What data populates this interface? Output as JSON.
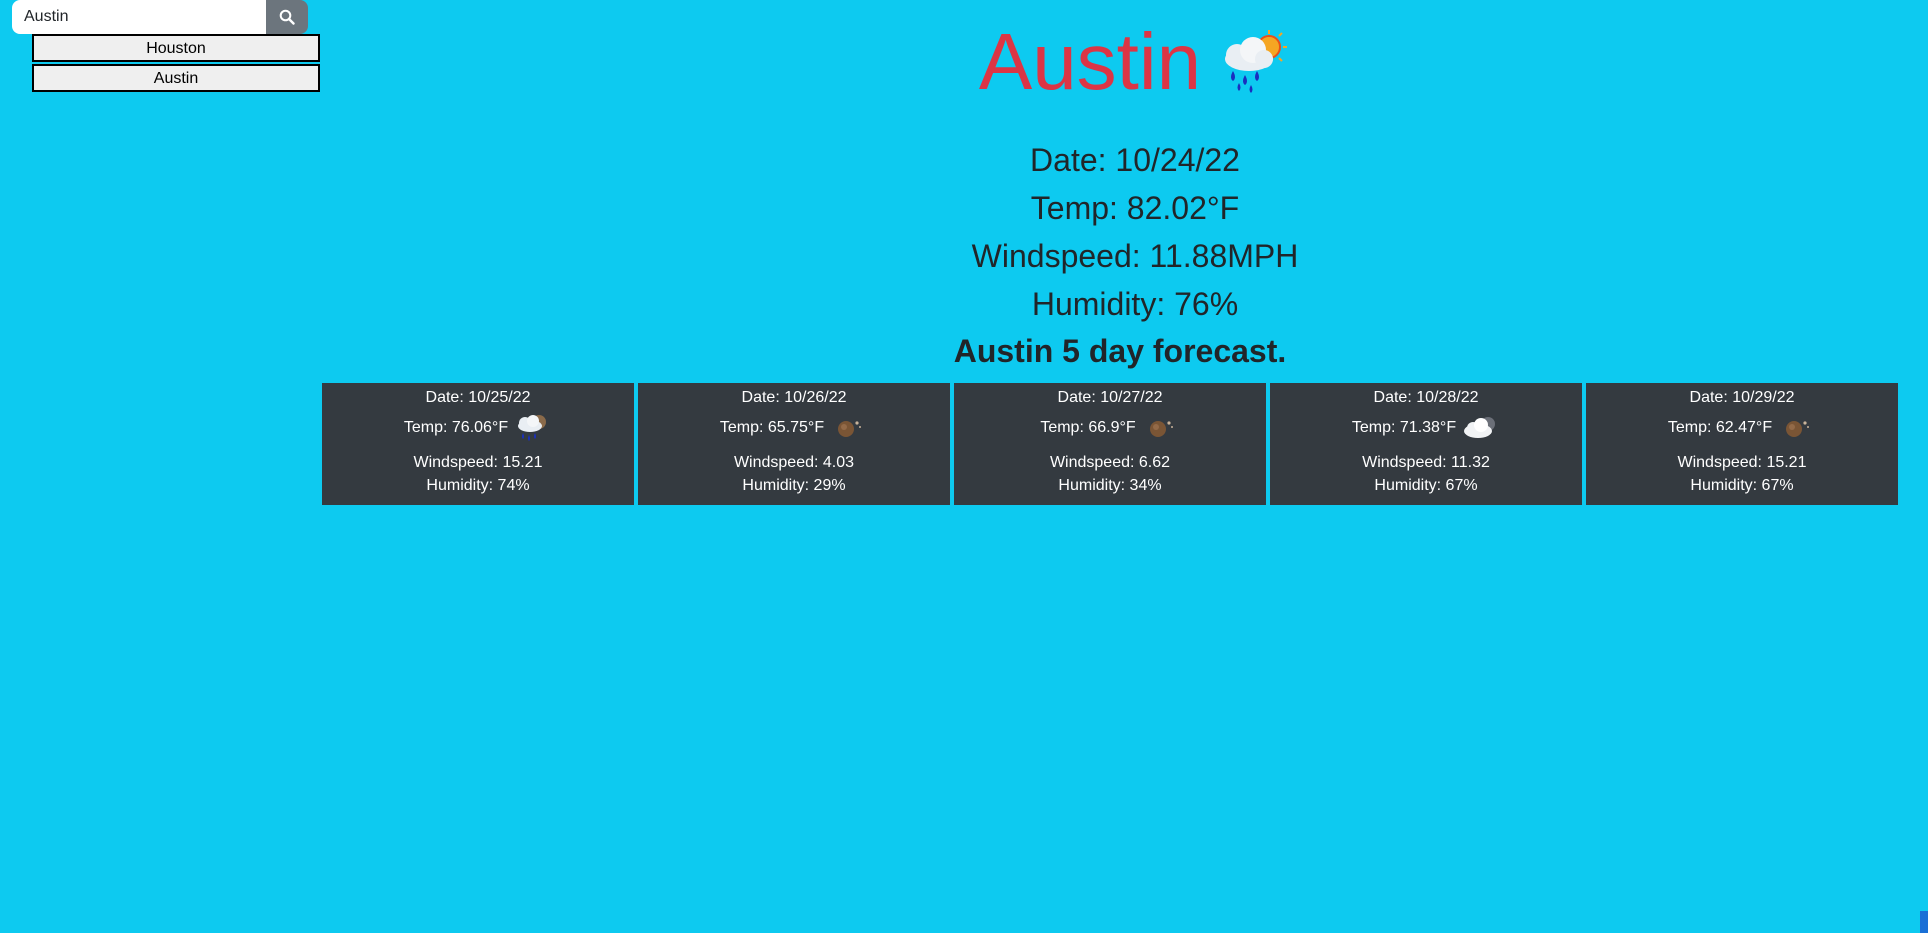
{
  "search": {
    "value": "Austin",
    "icon": "search-icon"
  },
  "history": [
    "Houston",
    "Austin"
  ],
  "current": {
    "city": "Austin",
    "icon": "rain-sun-icon",
    "date": "Date: 10/24/22",
    "temp": "Temp: 82.02°F",
    "windspeed": "Windspeed: 11.88MPH",
    "humidity": "Humidity: 76%"
  },
  "forecast_title": "Austin 5 day forecast.",
  "forecast": [
    {
      "date": "Date: 10/25/22",
      "temp": "Temp: 76.06°F",
      "icon": "rain-moon-icon",
      "windspeed": "Windspeed: 15.21",
      "humidity": "Humidity: 74%"
    },
    {
      "date": "Date: 10/26/22",
      "temp": "Temp: 65.75°F",
      "icon": "clear-night-icon",
      "windspeed": "Windspeed: 4.03",
      "humidity": "Humidity: 29%"
    },
    {
      "date": "Date: 10/27/22",
      "temp": "Temp: 66.9°F",
      "icon": "clear-night-icon",
      "windspeed": "Windspeed: 6.62",
      "humidity": "Humidity: 34%"
    },
    {
      "date": "Date: 10/28/22",
      "temp": "Temp: 71.38°F",
      "icon": "cloud-night-icon",
      "windspeed": "Windspeed: 11.32",
      "humidity": "Humidity: 67%"
    },
    {
      "date": "Date: 10/29/22",
      "temp": "Temp: 62.47°F",
      "icon": "clear-night-icon",
      "windspeed": "Windspeed: 15.21",
      "humidity": "Humidity: 67%"
    }
  ],
  "colors": {
    "background": "#0dcaf0",
    "city": "#dc3545",
    "card": "#343a40"
  }
}
